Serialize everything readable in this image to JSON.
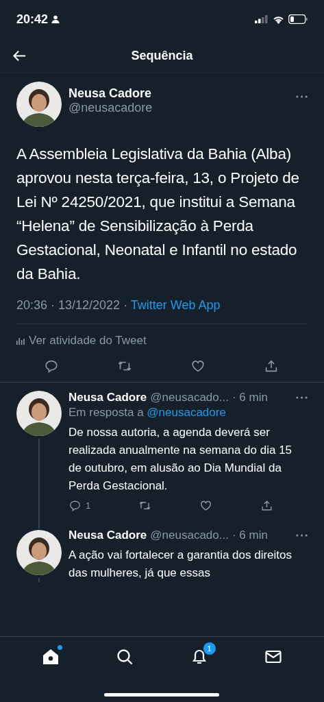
{
  "status_bar": {
    "time": "20:42"
  },
  "header": {
    "title": "Sequência"
  },
  "tweet": {
    "name": "Neusa Cadore",
    "handle": "@neusacadore",
    "text": "A Assembleia Legislativa da Bahia (Alba) aprovou nesta terça-feira, 13, o Projeto de Lei Nº 24250/2021, que institui a Semana “Helena” de Sensibilização à Perda Gestacional, Neonatal e Infantil no estado da Bahia.",
    "timestamp": "20:36 · 13/12/2022 · ",
    "source": "Twitter Web App",
    "activity": "Ver atividade do Tweet"
  },
  "replies": [
    {
      "name": "Neusa Cadore",
      "handle": "@neusacado...",
      "time": "· 6 min",
      "reply_to_label": "Em resposta a",
      "reply_to": "@neusacadore",
      "text": "De nossa autoria, a agenda deverá ser realizada anualmente na semana do dia 15 de outubro, em alusão ao Dia Mundial da Perda Gestacional.",
      "reply_count": "1"
    },
    {
      "name": "Neusa Cadore",
      "handle": "@neusacado...",
      "time": "· 6 min",
      "text": "A ação vai fortalecer a garantia dos direitos das mulheres, já que essas"
    }
  ],
  "tab_bar": {
    "home_dot": true,
    "notifications_badge": "1"
  }
}
